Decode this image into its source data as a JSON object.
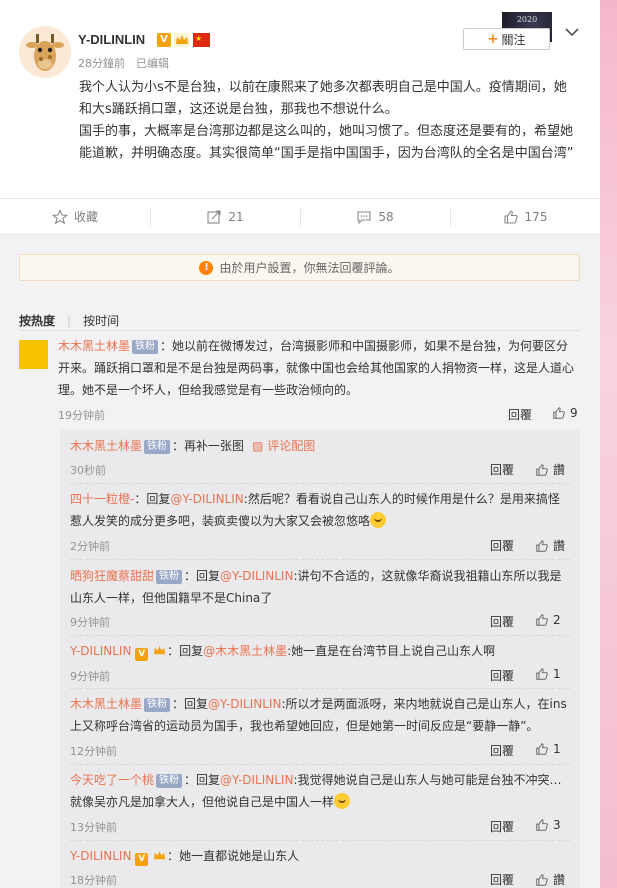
{
  "post": {
    "username": "Y-DILINLIN",
    "verified_badge": "V",
    "timestamp": "28分鐘前",
    "edited": "已编辑",
    "follow_label": "關注",
    "deco_text": "2020",
    "paragraph1": "我个人认为小s不是台独，以前在康熙来了她多次都表明自己是中国人。疫情期间，她和大s踊跃捐口罩，这还说是台独，那我也不想说什么。",
    "paragraph2": "国手的事，大概率是台湾那边都是这么叫的，她叫习惯了。但态度还是要有的，希望她能道歉，并明确态度。其实很简单“国手是指中国国手，因为台湾队的全名是中国台湾”"
  },
  "actions": {
    "favorite": "收藏",
    "repost_count": "21",
    "comment_count": "58",
    "like_count": "175"
  },
  "notice": "由於用户設置，你無法回覆評論。",
  "sort": {
    "hot": "按热度",
    "time": "按时间"
  },
  "top_comment": {
    "name": "木木黑土林墨",
    "badge": "铁粉",
    "text": "：她以前在微博发过，台湾摄影师和中国摄影师，如果不是台独，为何要区分开来。踊跃捐口罩和是不是台独是两码事，就像中国也会给其他国家的人捐物资一样，这是人道心理。她不是一个坏人，但给我感觉是有一些政治倾向的。",
    "time": "19分钟前",
    "reply": "回覆",
    "likes": "9"
  },
  "replies": [
    {
      "name": "木木黑土林墨",
      "badge": "铁粉",
      "text": "：再补一张图",
      "pic": "评论配图",
      "time": "30秒前",
      "reply": "回覆",
      "likes": "讚"
    },
    {
      "name": "四十一粒橙-",
      "prefix": "：回复",
      "at": "@Y-DILINLIN",
      "text": ":然后呢？看看说自己山东人的时候作用是什么？是用来搞怪惹人发笑的成分更多吧，装疯卖傻以为大家又会被忽悠咯",
      "time": "2分钟前",
      "reply": "回覆",
      "likes": "讚"
    },
    {
      "name": "晒狗狂魔蔡甜甜",
      "badge": "铁粉",
      "prefix": "：回复",
      "at": "@Y-DILINLIN",
      "text": ":讲句不合适的，这就像华裔说我祖籍山东所以我是山东人一样，但他国籍早不是China了",
      "time": "9分钟前",
      "reply": "回覆",
      "likes": "2"
    },
    {
      "name": "Y-DILINLIN",
      "vbadge": "V",
      "prefix": "：回复",
      "at": "@木木黑土林墨",
      "text": ":她一直是在台湾节目上说自己山东人啊",
      "time": "9分钟前",
      "reply": "回覆",
      "likes": "1"
    },
    {
      "name": "木木黑土林墨",
      "badge": "铁粉",
      "prefix": "：回复",
      "at": "@Y-DILINLIN",
      "text": ":所以才是两面派呀，来内地就说自己是山东人，在ins上又称呼台湾省的运动员为国手，我也希望她回应，但是她第一时间反应是“要静一静”。",
      "time": "12分钟前",
      "reply": "回覆",
      "likes": "1"
    },
    {
      "name": "今天吃了一个桃",
      "badge": "铁粉",
      "prefix": "：回复",
      "at": "@Y-DILINLIN",
      "text": ":我觉得她说自己是山东人与她可能是台独不冲突…就像吴亦凡是加拿大人，但他说自己是中国人一样",
      "time": "13分钟前",
      "reply": "回覆",
      "likes": "3"
    },
    {
      "name": "Y-DILINLIN",
      "vbadge": "V",
      "text": "：她一直都说她是山东人",
      "time": "18分钟前",
      "reply": "回覆",
      "likes": "讚"
    }
  ]
}
